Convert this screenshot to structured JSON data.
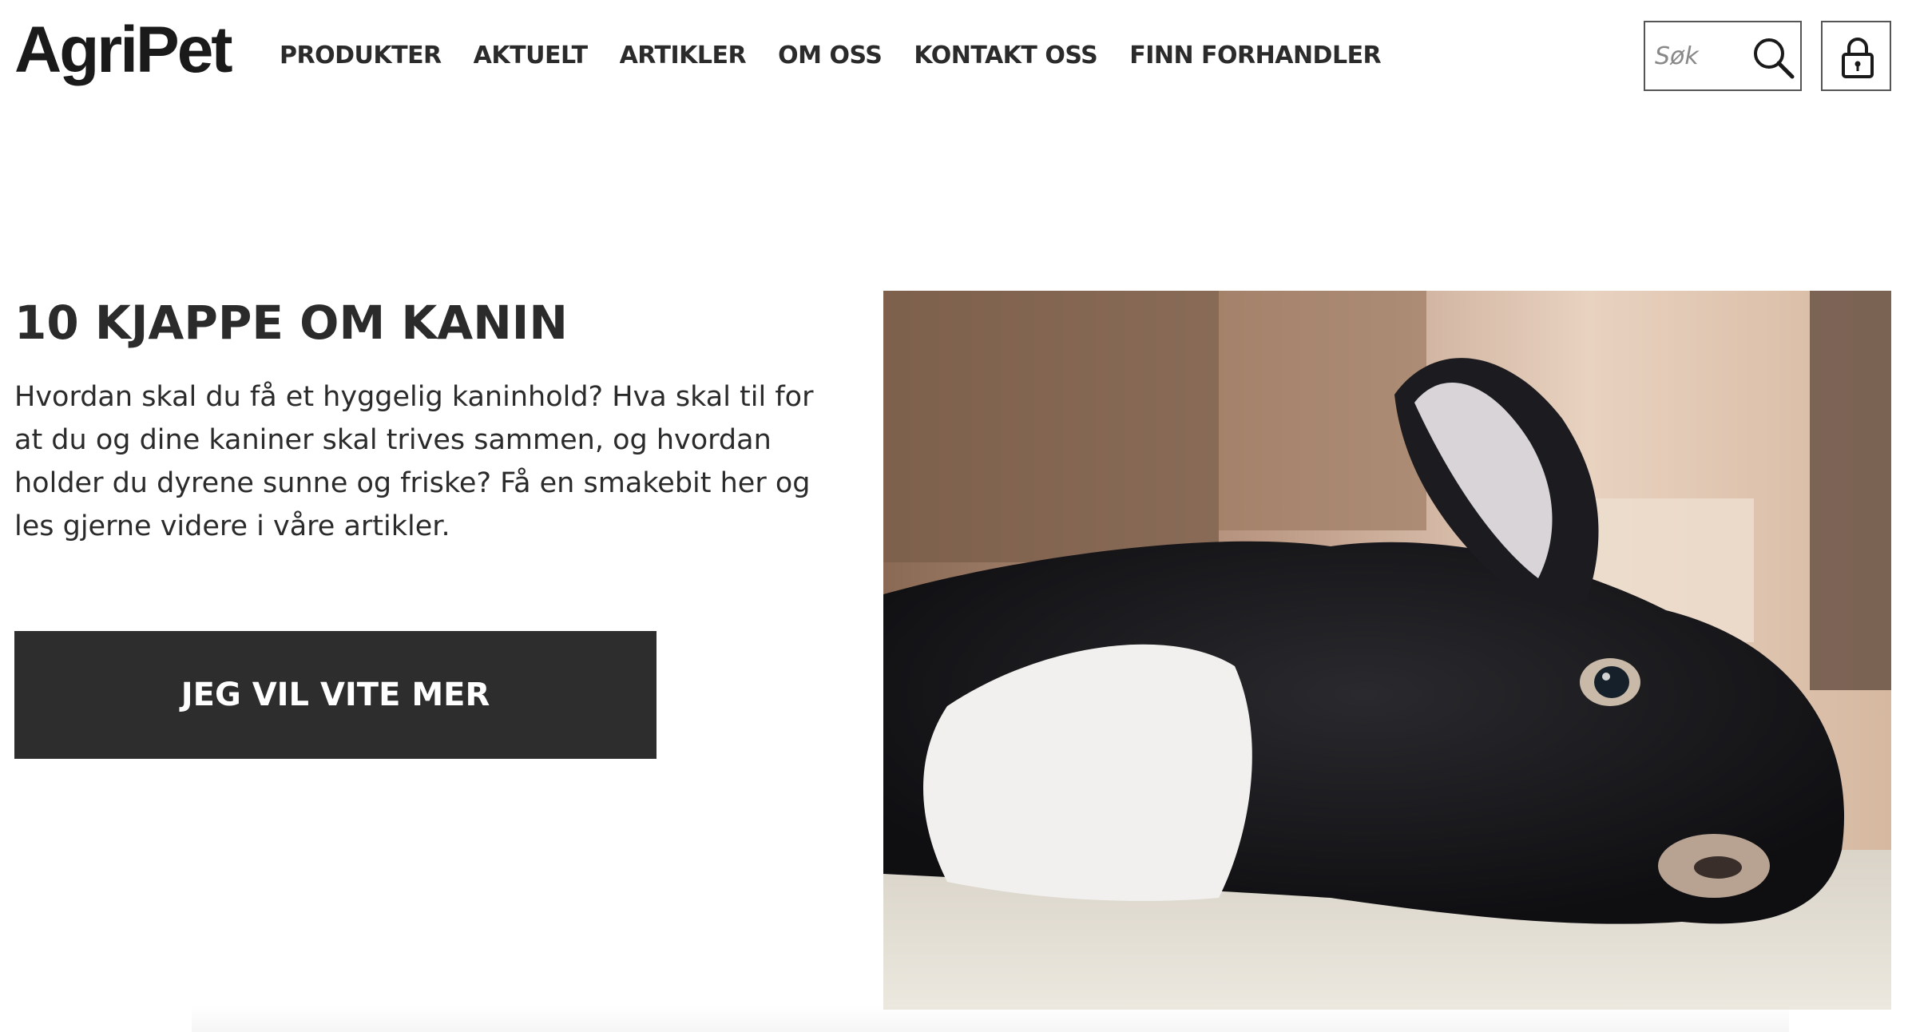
{
  "header": {
    "logo": "AgriPet",
    "nav": [
      {
        "label": "PRODUKTER"
      },
      {
        "label": "AKTUELT"
      },
      {
        "label": "ARTIKLER"
      },
      {
        "label": "OM OSS"
      },
      {
        "label": "KONTAKT OSS"
      },
      {
        "label": "FINN FORHANDLER"
      }
    ],
    "search": {
      "placeholder": "Søk",
      "icon": "search-icon"
    },
    "login": {
      "icon": "lock-icon"
    }
  },
  "hero": {
    "title": "10 KJAPPE OM KANIN",
    "text": "Hvordan skal du få et hyggelig kaninhold? Hva skal til for at du og dine kaniner skal trives sammen, og hvordan holder du dyrene sunne og friske? Få en smakebit her og les gjerne videre i våre artikler.",
    "button_label": "JEG VIL VITE MER",
    "image": "rabbit-photo"
  },
  "colors": {
    "text": "#2b2b2b",
    "button_bg": "#2d2d2d",
    "button_text": "#ffffff"
  }
}
